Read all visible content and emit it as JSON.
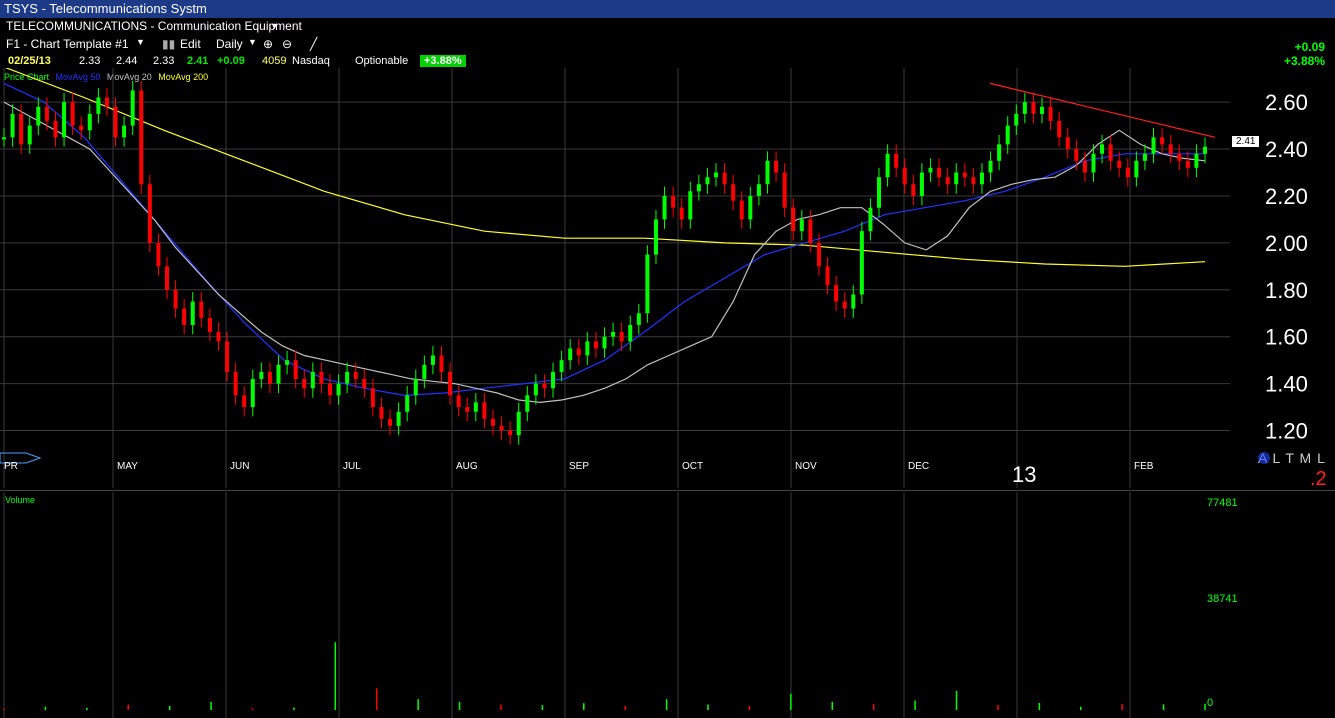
{
  "window": {
    "title": "TSYS - Telecommunications Systm"
  },
  "header": {
    "industry": "TELECOMMUNICATIONS - Communication Equipment",
    "template": "F1 - Chart Template #1",
    "edit_label": "Edit",
    "period": "Daily"
  },
  "quote": {
    "date": "02/25/13",
    "open": "2.33",
    "high": "2.44",
    "low": "2.33",
    "last": "2.41",
    "change": "+0.09",
    "volume": "4059",
    "exchange": "Nasdaq",
    "optionable": "Optionable",
    "pct_change": "+3.88%"
  },
  "summary": {
    "change": "+0.09",
    "pct": "+3.88%"
  },
  "legend": {
    "price": "Price Chart",
    "ma50": "MovAvg 50",
    "ma20": "MovAvg 20",
    "ma200": "MovAvg 200"
  },
  "right_panel": {
    "modes": "A L T M L",
    "year": "13",
    "tag": ".2",
    "last_price_tag": "2.41"
  },
  "volume_panel": {
    "label": "Volume",
    "ticks": [
      "77481",
      "38741",
      "0"
    ]
  },
  "colors": {
    "up": "#00ff00",
    "down": "#ff0000",
    "ma50": "#2233ff",
    "ma20": "#c0c0c0",
    "ma200": "#ffff33",
    "trend": "#ff2020"
  },
  "chart_data": {
    "type": "line",
    "title": "TSYS - Telecommunications Systm",
    "ylabel": "",
    "xlabel": "",
    "ylim": [
      1.1,
      2.72
    ],
    "y_ticks": [
      "2.60",
      "2.40",
      "2.20",
      "2.00",
      "1.80",
      "1.60",
      "1.40",
      "1.20"
    ],
    "month_labels": [
      "PR",
      "MAY",
      "JUN",
      "JUL",
      "AUG",
      "SEP",
      "OCT",
      "NOV",
      "DEC",
      "13",
      "FEB"
    ],
    "price_close": [
      2.45,
      2.55,
      2.42,
      2.5,
      2.58,
      2.52,
      2.45,
      2.6,
      2.5,
      2.48,
      2.55,
      2.62,
      2.58,
      2.45,
      2.5,
      2.65,
      2.25,
      2.0,
      1.9,
      1.8,
      1.72,
      1.65,
      1.75,
      1.68,
      1.62,
      1.58,
      1.45,
      1.35,
      1.3,
      1.42,
      1.45,
      1.4,
      1.48,
      1.5,
      1.42,
      1.38,
      1.45,
      1.4,
      1.35,
      1.4,
      1.45,
      1.42,
      1.38,
      1.3,
      1.25,
      1.22,
      1.28,
      1.35,
      1.42,
      1.48,
      1.52,
      1.45,
      1.35,
      1.3,
      1.28,
      1.32,
      1.25,
      1.22,
      1.2,
      1.18,
      1.28,
      1.35,
      1.4,
      1.38,
      1.45,
      1.5,
      1.55,
      1.52,
      1.58,
      1.55,
      1.6,
      1.62,
      1.58,
      1.65,
      1.7,
      1.95,
      2.1,
      2.2,
      2.15,
      2.1,
      2.22,
      2.25,
      2.28,
      2.3,
      2.25,
      2.18,
      2.1,
      2.2,
      2.25,
      2.35,
      2.3,
      2.15,
      2.05,
      2.1,
      2.0,
      1.9,
      1.82,
      1.75,
      1.72,
      1.78,
      2.05,
      2.15,
      2.28,
      2.38,
      2.32,
      2.25,
      2.2,
      2.3,
      2.32,
      2.28,
      2.25,
      2.3,
      2.28,
      2.25,
      2.3,
      2.35,
      2.42,
      2.5,
      2.55,
      2.6,
      2.55,
      2.58,
      2.52,
      2.45,
      2.4,
      2.35,
      2.3,
      2.38,
      2.42,
      2.35,
      2.32,
      2.28,
      2.35,
      2.38,
      2.45,
      2.42,
      2.38,
      2.35,
      2.32,
      2.38,
      2.41
    ],
    "ma20": [
      2.6,
      2.55,
      2.5,
      2.45,
      2.4,
      2.3,
      2.2,
      2.1,
      1.98,
      1.88,
      1.78,
      1.7,
      1.62,
      1.56,
      1.52,
      1.5,
      1.48,
      1.46,
      1.44,
      1.42,
      1.41,
      1.4,
      1.38,
      1.36,
      1.33,
      1.32,
      1.33,
      1.35,
      1.38,
      1.42,
      1.48,
      1.52,
      1.56,
      1.6,
      1.75,
      1.95,
      2.05,
      2.1,
      2.12,
      2.15,
      2.15,
      2.08,
      2.0,
      1.97,
      2.03,
      2.15,
      2.22,
      2.25,
      2.27,
      2.28,
      2.33,
      2.42,
      2.48,
      2.42,
      2.38,
      2.36,
      2.35
    ],
    "ma50": [
      2.68,
      2.6,
      2.45,
      2.25,
      2.05,
      1.85,
      1.66,
      1.5,
      1.42,
      1.38,
      1.35,
      1.36,
      1.38,
      1.4,
      1.42,
      1.5,
      1.62,
      1.75,
      1.85,
      1.95,
      2.0,
      2.05,
      2.12,
      2.15,
      2.18,
      2.22,
      2.28,
      2.35,
      2.38,
      2.38,
      2.38
    ],
    "ma200": [
      2.75,
      2.62,
      2.48,
      2.35,
      2.22,
      2.12,
      2.05,
      2.02,
      2.02,
      2.0,
      1.99,
      1.96,
      1.93,
      1.91,
      1.9,
      1.92
    ],
    "trendline": [
      2.68,
      2.45
    ],
    "volume": [
      500,
      1200,
      800,
      2000,
      1500,
      3000,
      600,
      900,
      25000,
      8000,
      4000,
      3000,
      2000,
      1800,
      2500,
      1500,
      4000,
      2000,
      1500,
      6000,
      3000,
      2200,
      3500,
      7000,
      1800,
      2600,
      1200,
      2200,
      2100,
      2300
    ]
  }
}
